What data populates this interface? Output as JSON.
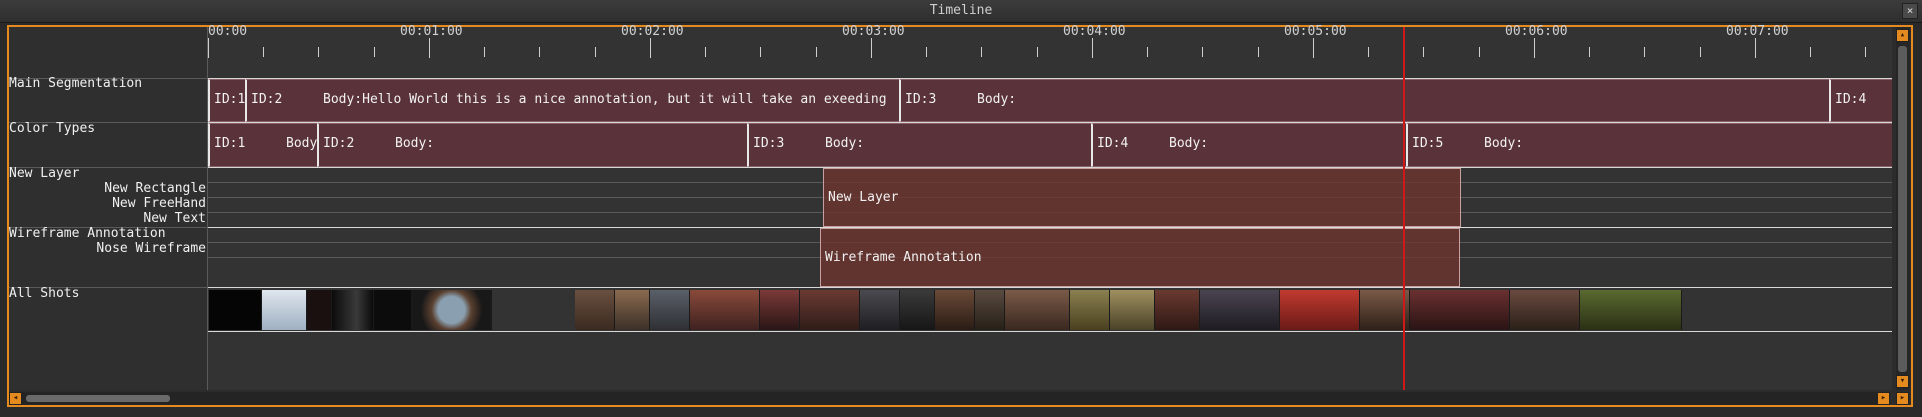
{
  "window": {
    "title": "Timeline",
    "close_glyph": "×"
  },
  "ruler": {
    "labels": [
      "00:00",
      "00:01:00",
      "00:02:00",
      "00:03:00",
      "00:04:00",
      "00:05:00",
      "00:06:00",
      "00:07:00"
    ]
  },
  "tracks": {
    "main_segmentation": "Main Segmentation",
    "color_types": "Color Types",
    "new_layer": "New Layer",
    "new_rectangle": "New Rectangle",
    "new_freehand": "New FreeHand",
    "new_text": "New Text",
    "wireframe_annotation": "Wireframe Annotation",
    "nose_wireframe": "Nose Wireframe",
    "all_shots": "All Shots"
  },
  "main_segments": [
    {
      "id": "ID:1",
      "body": ""
    },
    {
      "id": "ID:2",
      "body": "Body:Hello World this is a nice annotation, but it will take an exeeding"
    },
    {
      "id": "ID:3",
      "body": "Body:"
    },
    {
      "id": "ID:4",
      "body": ""
    }
  ],
  "color_segments": [
    {
      "id": "ID:1",
      "body": "Body"
    },
    {
      "id": "ID:2",
      "body": "Body:"
    },
    {
      "id": "ID:3",
      "body": "Body:"
    },
    {
      "id": "ID:4",
      "body": "Body:"
    },
    {
      "id": "ID:5",
      "body": "Body:"
    }
  ],
  "blocks": {
    "new_layer": "New Layer",
    "wireframe_annotation": "Wireframe Annotation"
  },
  "colors": {
    "accent": "#e58a1f",
    "playhead": "#d01818",
    "segment": "#5a3239",
    "block": "#6e342e"
  },
  "icons": {
    "scroll_left": "scroll-left-icon",
    "scroll_right": "scroll-right-icon",
    "scroll_up": "scroll-up-icon",
    "scroll_down": "scroll-down-icon",
    "close": "close-icon"
  }
}
